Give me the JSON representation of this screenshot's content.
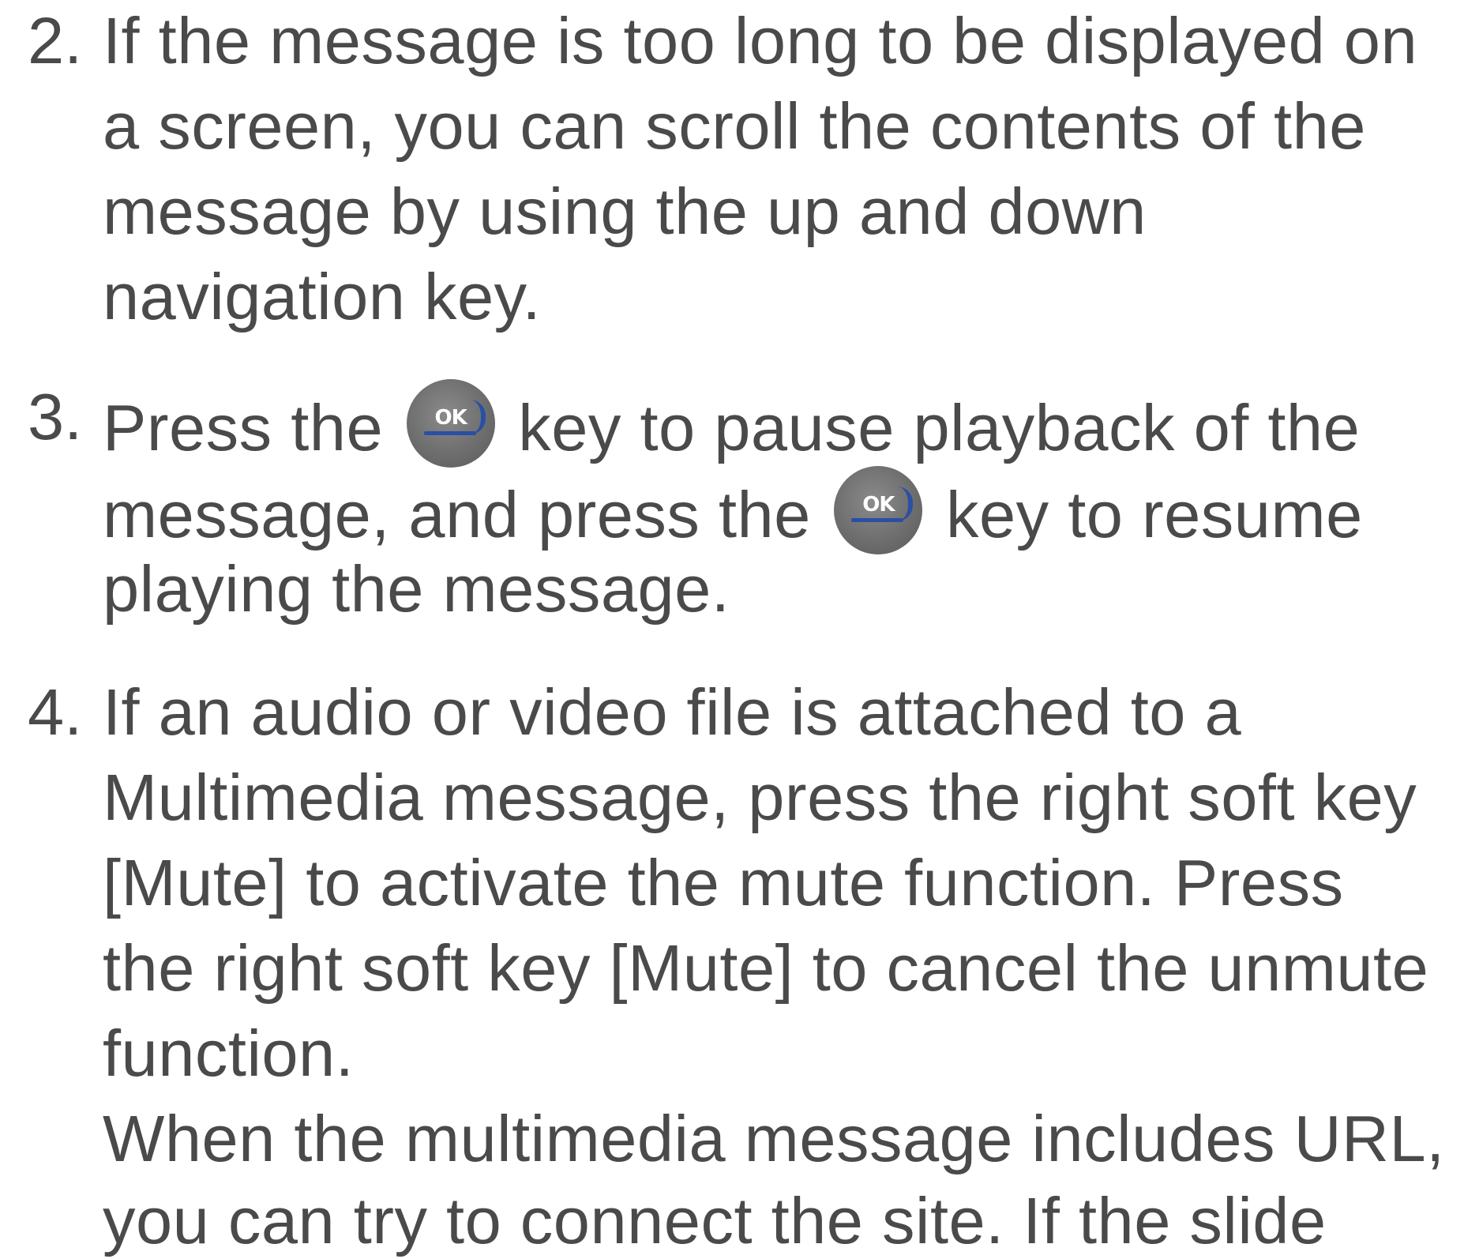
{
  "items": [
    {
      "number": "2.",
      "lines": [
        "If the message is too long to be displayed on",
        "a screen, you can scroll the contents of the",
        "message by using the up and down",
        "navigation key."
      ]
    },
    {
      "number": "3.",
      "line1_before": "Press the",
      "line1_after": "key to pause playback of the",
      "line2_before": "message, and press the",
      "line2_after": "key to resume",
      "line3": "playing the message.",
      "key_label": "OK"
    },
    {
      "number": "4.",
      "lines": [
        "If an audio or video file is attached to a",
        "Multimedia message, press the right soft key",
        "[Mute] to activate the mute function. Press",
        "the right soft key [Mute] to cancel the unmute",
        "function.",
        "When the multimedia message includes URL,",
        "you can try to connect the site. If the slide"
      ]
    }
  ]
}
